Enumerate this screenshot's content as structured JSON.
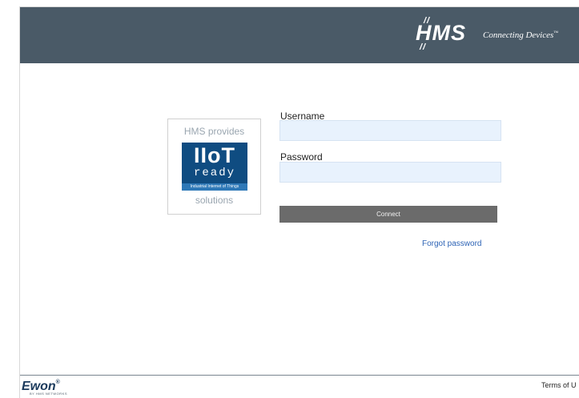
{
  "header": {
    "brand": "HMS",
    "tagline": "Connecting Devices",
    "trademark": "™"
  },
  "badge": {
    "top_text": "HMS provides",
    "main_text": "IIoT",
    "sub_text": "ready",
    "small_text": "Industrial Internet of Things",
    "bottom_text": "solutions"
  },
  "form": {
    "username_label": "Username",
    "username_value": "",
    "password_label": "Password",
    "password_value": "",
    "connect_label": "Connect",
    "forgot_label": "Forgot password"
  },
  "footer": {
    "brand": "Ewon",
    "brand_mark": "®",
    "brand_sub": "BY HMS NETWORKS",
    "terms_label": "Terms of U"
  },
  "colors": {
    "header_bg": "#4a5a67",
    "input_bg": "#e8f2fd",
    "button_bg": "#6b6b6b",
    "link": "#2d63b5",
    "badge_blue": "#0f4c81"
  }
}
